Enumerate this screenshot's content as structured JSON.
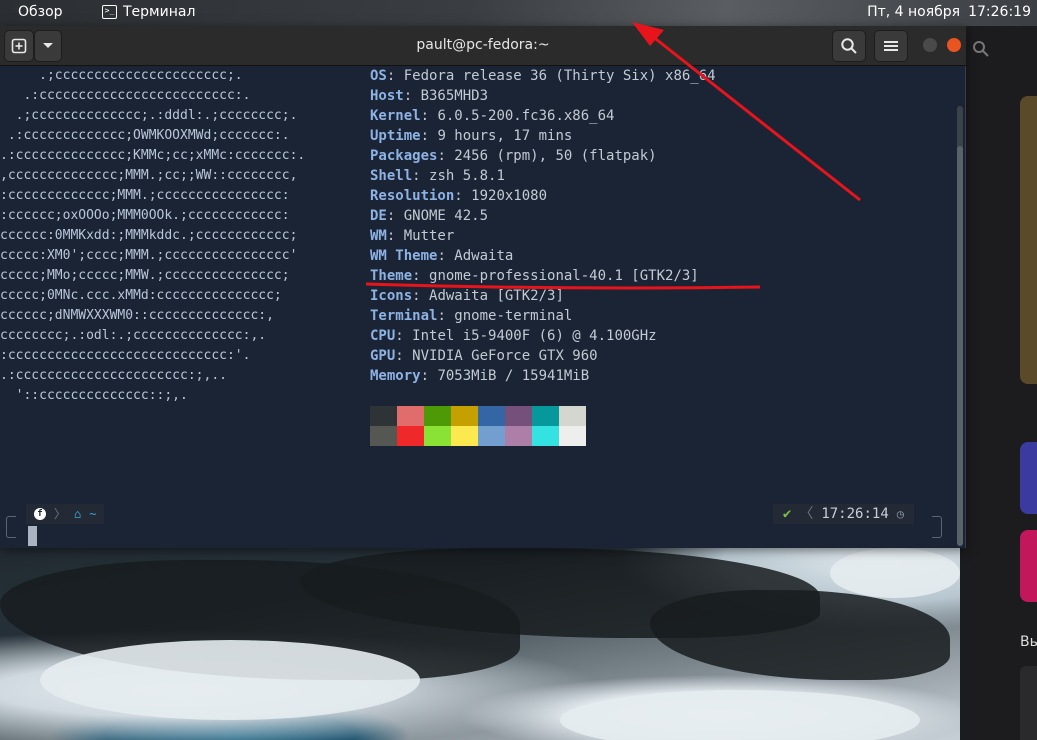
{
  "topbar": {
    "overview": "Обзор",
    "app_name": "Терминал",
    "date": "Пт, 4 ноября",
    "time": "17:26:19"
  },
  "terminal": {
    "title": "pault@pc-fedora:~",
    "logo_lines": [
      "     .;cccccccccccccccccccccc;.",
      "   .:ccccccccccccccccccccccccc:.",
      "  .;cccccccccccccc;.:dddl:.;cccccccc;.",
      " .:ccccccccccccc;OWMKOOXMWd;ccccccc:.",
      ".:cccccccccccccc;KMMc;cc;xMMc:ccccccc:.",
      ",cccccccccccccc;MMM.;cc;;WW::cccccccc,",
      ":ccccccccccccc;MMM.;cccccccccccccccc:",
      ":cccccc;oxOOOo;MMM0OOk.;cccccccccccc:",
      "cccccc:0MMKxdd:;MMMkddc.;cccccccccccc;",
      "ccccc:XM0';cccc;MMM.;cccccccccccccccc'",
      "ccccc;MMo;ccccc;MMW.;ccccccccccccccc;",
      "ccccc;0MNc.ccc.xMMd:ccccccccccccccc;",
      "cccccc;dNMWXXXWM0::cccccccccccccc:,",
      "cccccccc;.:odl:.;cccccccccccccc:,.",
      ":cccccccccccccccccccccccccccc:'.",
      ".:cccccccccccccccccccccc:;,..",
      "  '::cccccccccccccc::;,."
    ],
    "info": [
      {
        "key": "OS",
        "value": "Fedora release 36 (Thirty Six) x86_64"
      },
      {
        "key": "Host",
        "value": "B365MHD3"
      },
      {
        "key": "Kernel",
        "value": "6.0.5-200.fc36.x86_64"
      },
      {
        "key": "Uptime",
        "value": "9 hours, 17 mins"
      },
      {
        "key": "Packages",
        "value": "2456 (rpm), 50 (flatpak)"
      },
      {
        "key": "Shell",
        "value": "zsh 5.8.1"
      },
      {
        "key": "Resolution",
        "value": "1920x1080"
      },
      {
        "key": "DE",
        "value": "GNOME 42.5"
      },
      {
        "key": "WM",
        "value": "Mutter"
      },
      {
        "key": "WM Theme",
        "value": "Adwaita"
      },
      {
        "key": "Theme",
        "value": "gnome-professional-40.1 [GTK2/3]"
      },
      {
        "key": "Icons",
        "value": "Adwaita [GTK2/3]"
      },
      {
        "key": "Terminal",
        "value": "gnome-terminal"
      },
      {
        "key": "CPU",
        "value": "Intel i5-9400F (6) @ 4.100GHz"
      },
      {
        "key": "GPU",
        "value": "NVIDIA GeForce GTX 960"
      },
      {
        "key": "Memory",
        "value": "7053MiB / 15941MiB"
      }
    ],
    "palette": [
      "#2e3436",
      "#e06c6c",
      "#4e9a06",
      "#c4a000",
      "#3465a4",
      "#75507b",
      "#06989a",
      "#d3d7cf",
      "#555753",
      "#ef2929",
      "#8ae234",
      "#fce94f",
      "#729fcf",
      "#ad7fa8",
      "#34e2e2",
      "#eeeeec"
    ],
    "prompt": {
      "path": "~",
      "time": "17:26:14"
    }
  },
  "side": {
    "text": "Вы"
  },
  "colors": {
    "annotation": "#e8141c",
    "info_key": "#8db2e4",
    "side_card_1": "#5a4a2a",
    "side_card_2": "#3b3aa0",
    "side_card_3": "#c2185b"
  }
}
